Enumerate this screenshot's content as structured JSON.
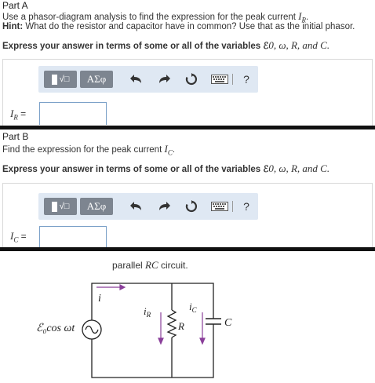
{
  "partA": {
    "title": "Part A",
    "instruction": "Use a phasor-diagram analysis to find the expression for the peak current",
    "instruction_var": "I",
    "instruction_sub": "R",
    "hint_label": "Hint:",
    "hint_text": "What do the resistor and capacitor have in common? Use that as the initial phasor.",
    "express": "Express your answer in terms of some or all of the variables ℰ",
    "express_vars": "0, ω, R, and C.",
    "answer_label_var": "I",
    "answer_label_sub": "R",
    "equals": "=",
    "toolbar": {
      "template_label": "√□",
      "greek_label": "ΑΣφ",
      "help_label": "?"
    }
  },
  "partB": {
    "title": "Part B",
    "instruction": "Find the expression for the peak current",
    "instruction_var": "I",
    "instruction_sub": "C",
    "express": "Express your answer in terms of some or all of the variables ℰ",
    "express_vars": "0, ω, R, and C.",
    "answer_label_var": "I",
    "answer_label_sub": "C",
    "equals": "=",
    "toolbar": {
      "template_label": "√□",
      "greek_label": "ΑΣφ",
      "help_label": "?"
    }
  },
  "figure": {
    "caption_pre": "parallel",
    "caption_var": "RC",
    "caption_post": "circuit.",
    "source_label": "ℰ₀cos ωt",
    "current_i": "i",
    "current_iR": "iR",
    "current_iC": "iC",
    "resistor_label": "R",
    "capacitor_label": "C"
  },
  "colors": {
    "toolbar_bg": "#dfe8f3",
    "button_bg": "#7d8590",
    "input_border": "#7aa0c8",
    "arrow_purple": "#8a3f9a"
  }
}
